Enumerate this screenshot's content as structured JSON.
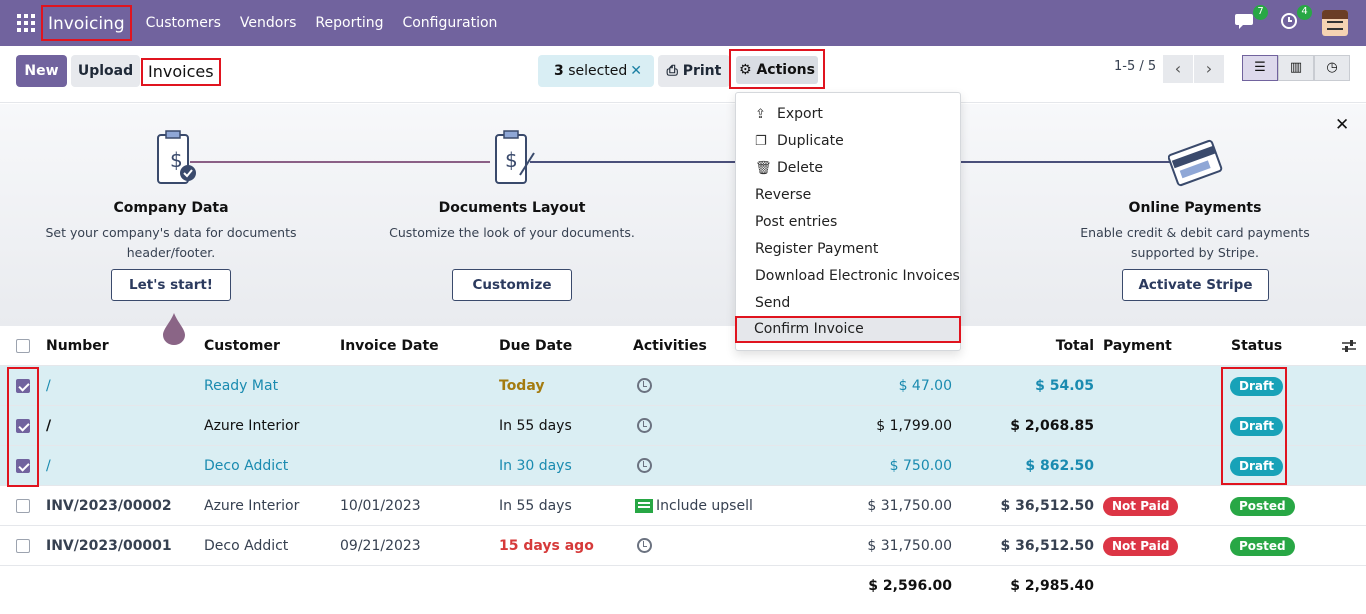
{
  "navbar": {
    "app_name": "Invoicing",
    "menu": [
      "Customers",
      "Vendors",
      "Reporting",
      "Configuration"
    ],
    "messages_count": "7",
    "activities_count": "4"
  },
  "control_panel": {
    "new_label": "New",
    "upload_label": "Upload",
    "breadcrumb": "Invoices",
    "selected_count": "3",
    "selected_suffix": "selected",
    "print_label": "Print",
    "actions_label": "Actions",
    "pager": "1-5 / 5"
  },
  "banner": {
    "steps": [
      {
        "title": "Company Data",
        "desc_line1": "Set your company's data for documents",
        "desc_line2": "header/footer.",
        "button": "Let's start!"
      },
      {
        "title": "Documents Layout",
        "desc_line1": "Customize the look of your documents.",
        "desc_line2": "",
        "button": "Customize"
      },
      {
        "title": "Online Payments",
        "desc_line1": "Enable credit & debit card payments",
        "desc_line2": "supported by Stripe.",
        "button": "Activate Stripe"
      }
    ]
  },
  "actions_menu": {
    "items": [
      "Export",
      "Duplicate",
      "Delete",
      "Reverse",
      "Post entries",
      "Register Payment",
      "Download Electronic Invoices",
      "Send"
    ],
    "confirm": "Confirm Invoice"
  },
  "table": {
    "headers": {
      "number": "Number",
      "customer": "Customer",
      "invoice_date": "Invoice Date",
      "due_date": "Due Date",
      "activities": "Activities",
      "total": "Total",
      "payment": "Payment",
      "status": "Status"
    },
    "rows": [
      {
        "number": "/",
        "customer": "Ready Mat",
        "invoice_date": "",
        "due_date": "Today",
        "activity": "",
        "untaxed": "$ 47.00",
        "total": "$ 54.05",
        "payment": "",
        "status": "Draft"
      },
      {
        "number": "/",
        "customer": "Azure Interior",
        "invoice_date": "",
        "due_date": "In 55 days",
        "activity": "",
        "untaxed": "$ 1,799.00",
        "total": "$ 2,068.85",
        "payment": "",
        "status": "Draft"
      },
      {
        "number": "/",
        "customer": "Deco Addict",
        "invoice_date": "",
        "due_date": "In 30 days",
        "activity": "",
        "untaxed": "$ 750.00",
        "total": "$ 862.50",
        "payment": "",
        "status": "Draft"
      },
      {
        "number": "INV/2023/00002",
        "customer": "Azure Interior",
        "invoice_date": "10/01/2023",
        "due_date": "In 55 days",
        "activity": "Include upsell",
        "untaxed": "$ 31,750.00",
        "total": "$ 36,512.50",
        "payment": "Not Paid",
        "status": "Posted"
      },
      {
        "number": "INV/2023/00001",
        "customer": "Deco Addict",
        "invoice_date": "09/21/2023",
        "due_date": "15 days ago",
        "activity": "",
        "untaxed": "$ 31,750.00",
        "total": "$ 36,512.50",
        "payment": "Not Paid",
        "status": "Posted"
      }
    ],
    "footer": {
      "untaxed_sum": "$ 2,596.00",
      "total_sum": "$ 2,985.40"
    }
  },
  "colors": {
    "brand": "#71639e",
    "draft": "#17a2b8",
    "posted": "#28a745",
    "not_paid": "#dc3545",
    "highlight": "#e0141f"
  }
}
